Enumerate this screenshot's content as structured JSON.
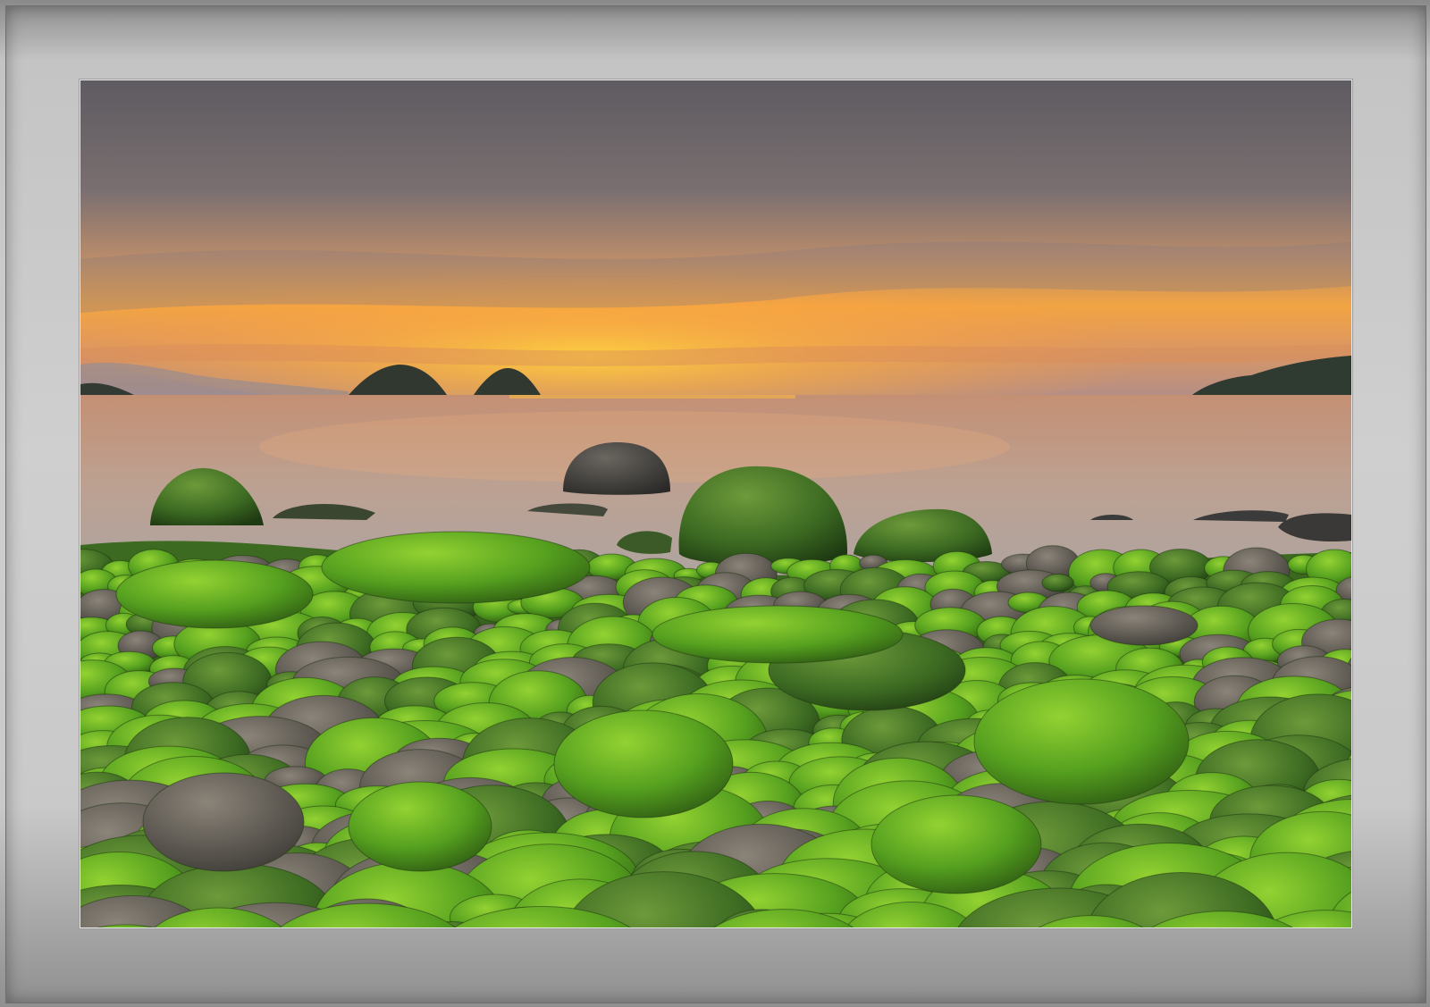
{
  "scene": {
    "subject": "sunset-seascape-mossy-rocks",
    "colors": {
      "sky_top": "#5f5c62",
      "sky_glow": "#f6b640",
      "sea": "#c7a289",
      "moss": "#4e9a1f",
      "moss_light": "#86c42c",
      "frame": "#c8c8c8"
    }
  }
}
